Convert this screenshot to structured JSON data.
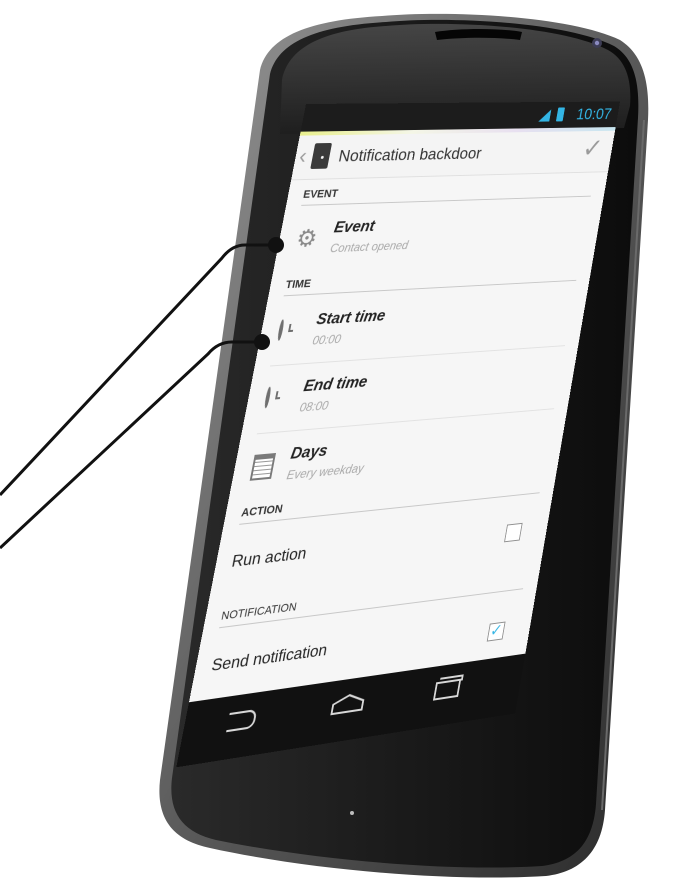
{
  "status_bar": {
    "time": "10:07",
    "signal_icon": "signal-icon",
    "battery_icon": "battery-icon",
    "accent_color": "#33b5e5"
  },
  "action_bar": {
    "back_icon": "chevron-left-icon",
    "title": "Notification backdoor",
    "done_icon": "check-icon"
  },
  "sections": {
    "event": "EVENT",
    "time": "TIME",
    "action": "ACTION",
    "notification": "NOTIFICATION"
  },
  "items": {
    "event": {
      "title": "Event",
      "subtitle": "Contact opened",
      "icon": "gear-icon"
    },
    "start_time": {
      "title": "Start time",
      "subtitle": "00:00",
      "icon": "clock-icon"
    },
    "end_time": {
      "title": "End time",
      "subtitle": "08:00",
      "icon": "clock-icon"
    },
    "days": {
      "title": "Days",
      "subtitle": "Every weekday",
      "icon": "calendar-icon"
    }
  },
  "toggles": {
    "run_action": {
      "label": "Run action",
      "checked": false
    },
    "send_notification": {
      "label": "Send notification",
      "checked": true
    }
  },
  "nav_bar": {
    "back_icon": "back-icon",
    "home_icon": "home-icon",
    "recents_icon": "recents-icon"
  }
}
